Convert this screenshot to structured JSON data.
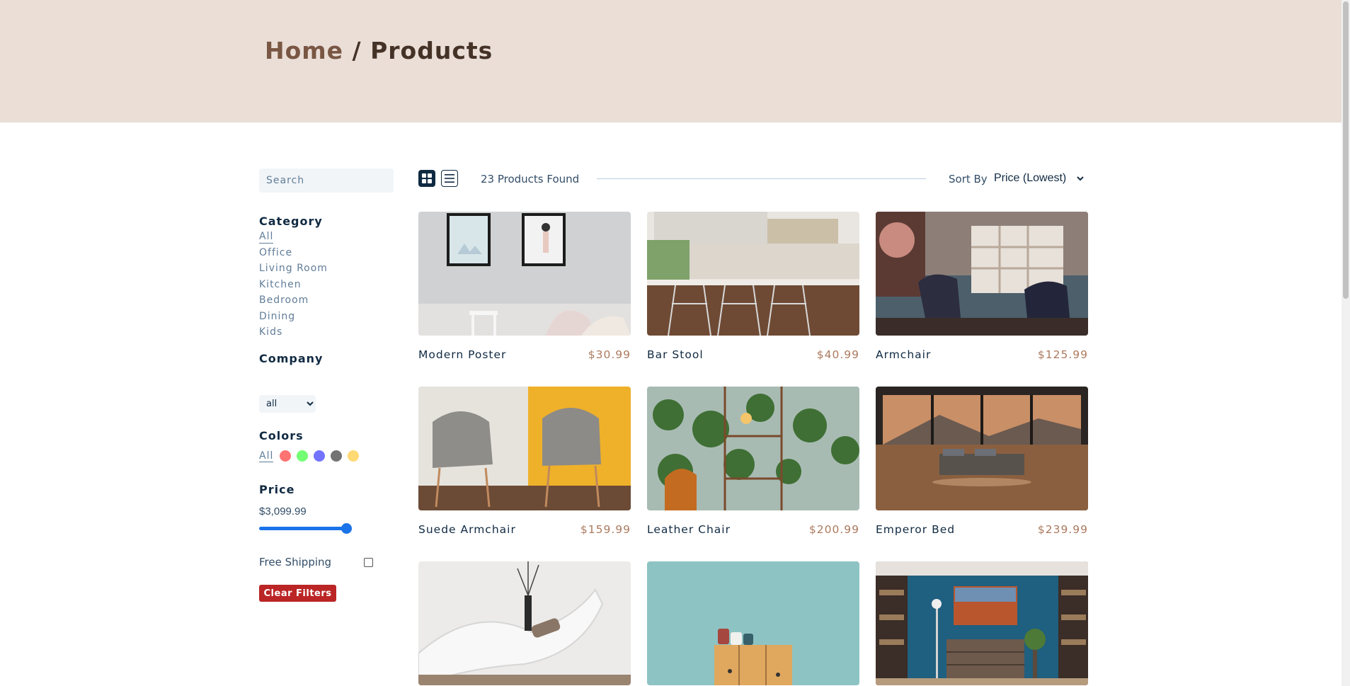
{
  "hero": {
    "home_label": "Home",
    "separator": " / ",
    "current_label": "Products"
  },
  "filters": {
    "search_placeholder": "Search",
    "category_title": "Category",
    "categories": [
      "All",
      "Office",
      "Living Room",
      "Kitchen",
      "Bedroom",
      "Dining",
      "Kids"
    ],
    "active_category": "All",
    "company_title": "Company",
    "company_selected": "all",
    "colors_title": "Colors",
    "colors_all_label": "All",
    "colors": [
      "#ff0000",
      "#00ff00",
      "#0000ff",
      "#000000",
      "#ffb900"
    ],
    "price_title": "Price",
    "price_value": "$3,099.99",
    "price_level": 1.0,
    "free_shipping_label": "Free Shipping",
    "free_shipping_checked": false,
    "clear_label": "Clear Filters"
  },
  "toolbar": {
    "grid_view_active": true,
    "count_text": "23 Products Found",
    "sort_label": "Sort By",
    "sort_value": "Price (Lowest)"
  },
  "products": [
    {
      "name": "Modern Poster",
      "price": "$30.99",
      "image": "poster"
    },
    {
      "name": "Bar Stool",
      "price": "$40.99",
      "image": "kitchen"
    },
    {
      "name": "Armchair",
      "price": "$125.99",
      "image": "shelf"
    },
    {
      "name": "Suede Armchair",
      "price": "$159.99",
      "image": "chairs"
    },
    {
      "name": "Leather Chair",
      "price": "$200.99",
      "image": "plants"
    },
    {
      "name": "Emperor Bed",
      "price": "$239.99",
      "image": "bed"
    },
    {
      "name": "",
      "price": "",
      "image": "lounge"
    },
    {
      "name": "",
      "price": "",
      "image": "cabinet"
    },
    {
      "name": "",
      "price": "",
      "image": "blueroom"
    }
  ]
}
